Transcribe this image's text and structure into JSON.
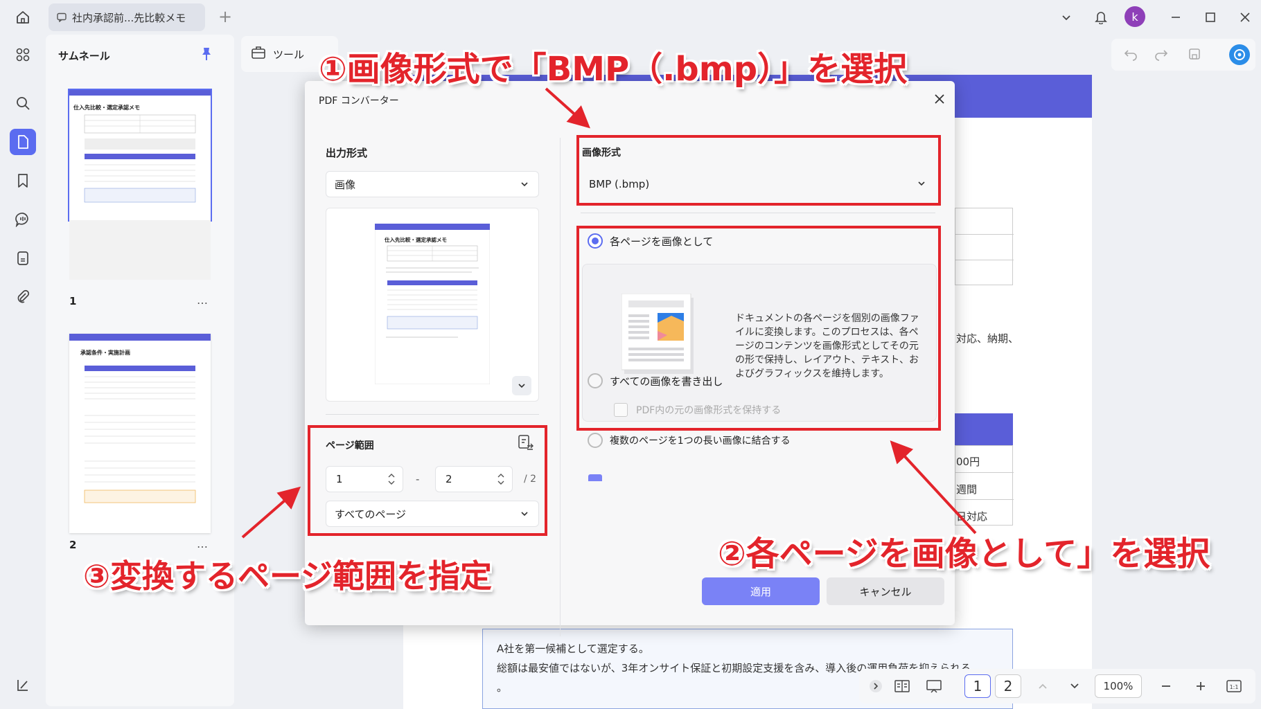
{
  "window": {
    "tab_title": "社内承認前...先比較メモ",
    "avatar_letter": "k"
  },
  "thumbnails": {
    "title": "サムネール",
    "pages": [
      {
        "number": "1",
        "heading": "仕入先比較・選定承認メモ"
      },
      {
        "number": "2",
        "heading": "承認条件・実施計画"
      }
    ],
    "more": "…"
  },
  "toolbar": {
    "tools_label": "ツール"
  },
  "document": {
    "snippet_1": "対応、納期、",
    "cell_1": "00円",
    "cell_2": "週間",
    "cell_3": "日対応",
    "note_line_1": "A社を第一候補として選定する。",
    "note_line_2": "総額は最安値ではないが、3年オンサイト保証と初期設定支援を含み、導入後の運用負荷を抑えられる",
    "note_line_3": "。"
  },
  "bottom_bar": {
    "page_1": "1",
    "page_2": "2",
    "zoom": "100%"
  },
  "dialog": {
    "title": "PDF コンバーター",
    "output_format_label": "出力形式",
    "output_format_value": "画像",
    "image_format_label": "画像形式",
    "image_format_value": "BMP (.bmp)",
    "page_range_label": "ページ範囲",
    "range_from": "1",
    "range_sep": "-",
    "range_to": "2",
    "range_total": "/ 2",
    "range_select": "すべてのページ",
    "option_each_page": "各ページを画像として",
    "description": "ドキュメントの各ページを個別の画像ファイルに変換します。このプロセスは、各ページのコンテンツを画像形式としてその元の形で保持し、レイアウト、テキスト、およびグラフィックスを維持します。",
    "option_extract_all": "すべての画像を書き出し",
    "option_keep_format": "PDF内の元の画像形式を保持する",
    "option_combine": "複数のページを1つの長い画像に結合する",
    "apply": "適用",
    "cancel": "キャンセル"
  },
  "annotations": {
    "step1": "①画像形式で「BMP（.bmp）」を選択",
    "step2": "②各ページを画像として」を選択",
    "step3": "③変換するページ範囲を指定",
    "color": "#e3242b"
  }
}
